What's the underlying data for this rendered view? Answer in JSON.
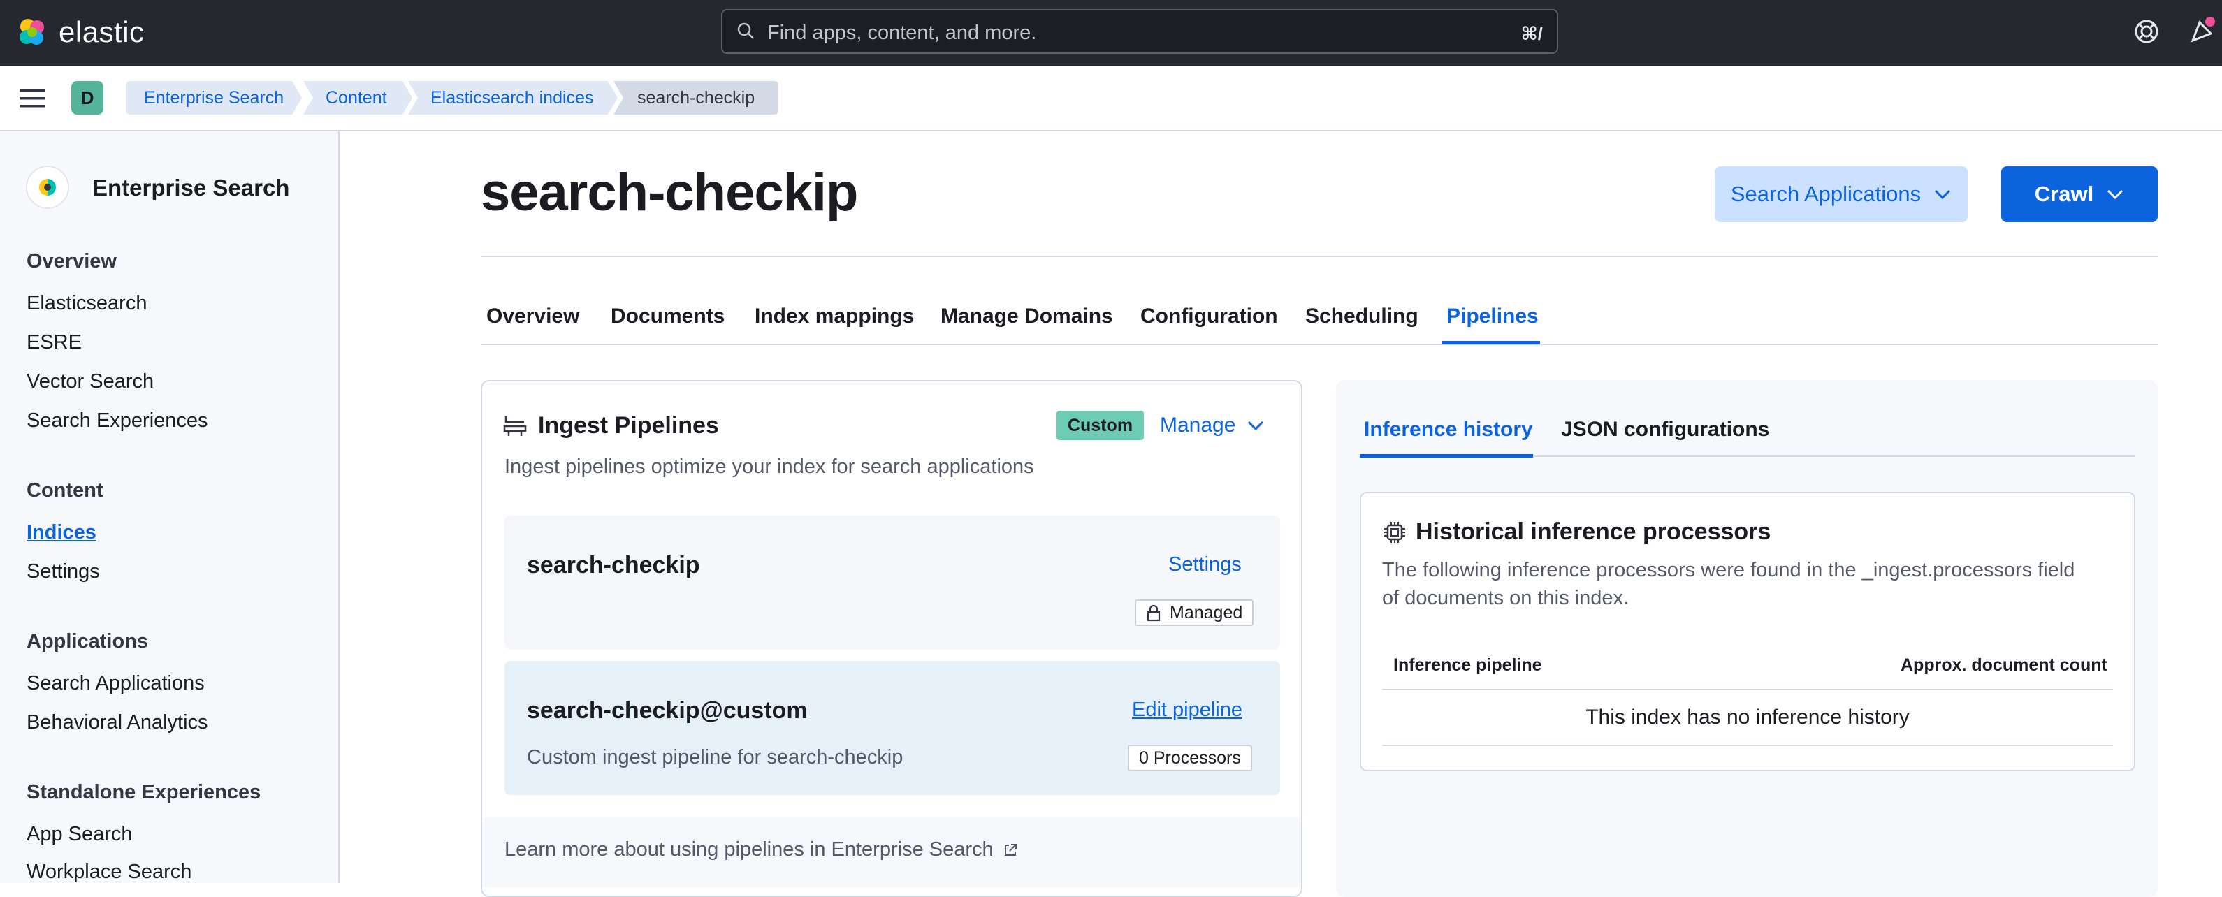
{
  "header": {
    "brand": "elastic",
    "search_placeholder": "Find apps, content, and more.",
    "search_shortcut": "⌘/"
  },
  "nav": {
    "avatar": "D",
    "breadcrumbs": [
      "Enterprise Search",
      "Content",
      "Elasticsearch indices",
      "search-checkip"
    ]
  },
  "sidebar": {
    "title": "Enterprise Search",
    "sections": [
      {
        "heading": "Overview",
        "items": [
          "Elasticsearch",
          "ESRE",
          "Vector Search",
          "Search Experiences"
        ]
      },
      {
        "heading": "Content",
        "items": [
          "Indices",
          "Settings"
        ]
      },
      {
        "heading": "Applications",
        "items": [
          "Search Applications",
          "Behavioral Analytics"
        ]
      },
      {
        "heading": "Standalone Experiences",
        "items": [
          "App Search",
          "Workplace Search"
        ]
      }
    ],
    "active_item": "Indices"
  },
  "page": {
    "title": "search-checkip",
    "search_applications_button": "Search Applications",
    "crawl_button": "Crawl",
    "tabs": [
      "Overview",
      "Documents",
      "Index mappings",
      "Manage Domains",
      "Configuration",
      "Scheduling",
      "Pipelines"
    ],
    "active_tab": "Pipelines"
  },
  "ingest": {
    "title": "Ingest Pipelines",
    "badge": "Custom",
    "manage": "Manage",
    "description": "Ingest pipelines optimize your index for search applications",
    "pipeline1": {
      "name": "search-checkip",
      "action": "Settings",
      "badge": "Managed"
    },
    "pipeline2": {
      "name": "search-checkip@custom",
      "action": "Edit pipeline",
      "description": "Custom ingest pipeline for search-checkip",
      "badge": "0 Processors"
    },
    "footer_link": "Learn more about using pipelines in Enterprise Search"
  },
  "inference": {
    "tabs": [
      "Inference history",
      "JSON configurations"
    ],
    "active_tab": "Inference history",
    "title": "Historical inference processors",
    "description_line1": "The following inference processors were found in the _ingest.processors field",
    "description_line2": "of documents on this index.",
    "col_pipeline": "Inference pipeline",
    "col_count": "Approx. document count",
    "empty": "This index has no inference history"
  },
  "colors": {
    "accent": "#0b64dd",
    "header_bg": "#25282f",
    "custom_badge": "#6dccb1"
  }
}
